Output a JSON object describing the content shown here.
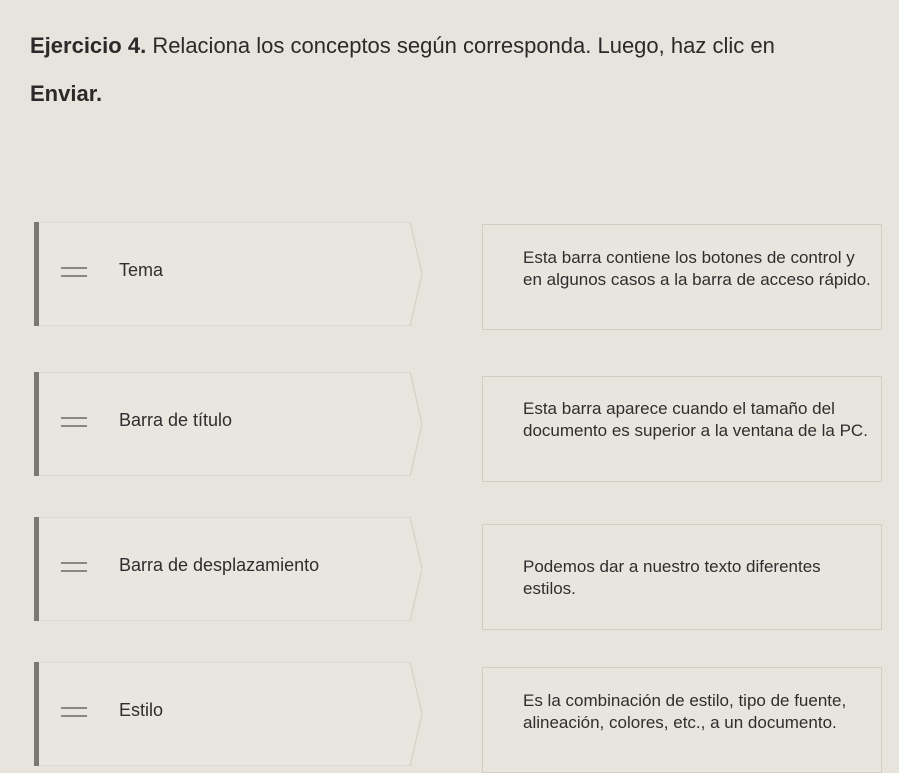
{
  "instructions": {
    "exercise_label": "Ejercicio 4.",
    "text_before": "Relaciona los conceptos según corresponda. Luego, haz clic en",
    "send_word": "Enviar",
    "period": "."
  },
  "concepts": [
    {
      "label": "Tema",
      "icon": "drag-handle-icon"
    },
    {
      "label": "Barra de título",
      "icon": "drag-handle-icon"
    },
    {
      "label": "Barra de desplazamiento",
      "icon": "drag-handle-icon"
    },
    {
      "label": "Estilo",
      "icon": "drag-handle-icon"
    }
  ],
  "definitions": [
    {
      "text": "Esta barra contiene los botones de control y en algunos casos a la barra de acceso rápido."
    },
    {
      "text": "Esta barra aparece cuando el tamaño del documento es superior a la ventana de la PC."
    },
    {
      "text": "Podemos dar a nuestro texto diferentes estilos."
    },
    {
      "text": "Es la combinación de estilo, tipo de fuente, alineación, colores, etc., a un documento."
    }
  ],
  "colors": {
    "background": "#e7e4dd",
    "card": "#e9e6df",
    "accent": "#7a7874",
    "text": "#2a2a2a"
  }
}
